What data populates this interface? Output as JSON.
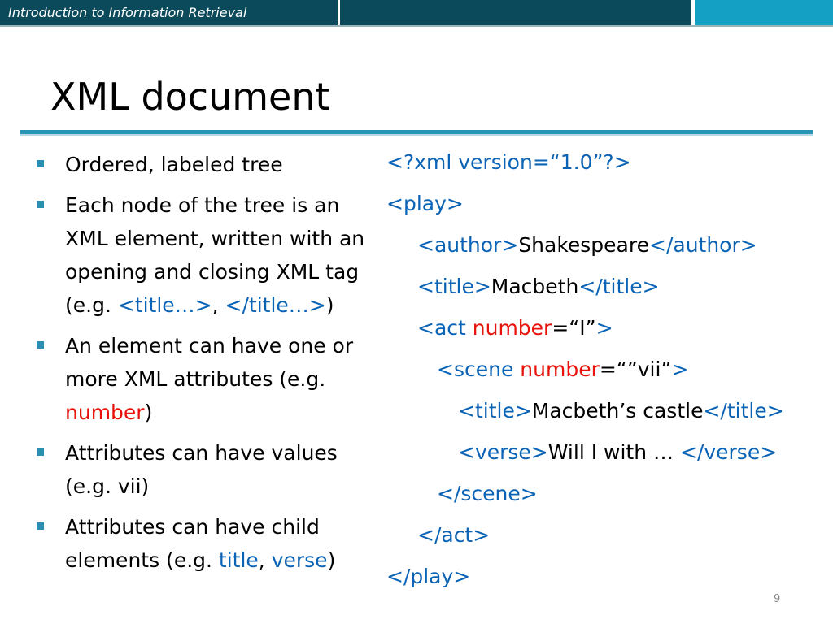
{
  "header": {
    "course": "Introduction to Information Retrieval"
  },
  "slide": {
    "title": "XML document",
    "page_number": "9",
    "colors": {
      "bar_dark": "#0b4a5a",
      "bar_light": "#14a0c4",
      "rule": "#2794b8",
      "tag_blue": "#0a63b5",
      "attr_red": "#e8120b"
    }
  },
  "bullets": {
    "b1": {
      "t1": "Ordered, labeled tree"
    },
    "b2": {
      "t1": "Each node of the tree is an XML element, written with an opening and closing XML tag (e.g. ",
      "t2": "<title…>",
      "t3": ", ",
      "t4": "</title…>",
      "t5": ")"
    },
    "b3": {
      "t1": "An element can have one or more XML attributes (e.g. ",
      "t2": "number",
      "t3": ")"
    },
    "b4": {
      "t1": "Attributes can have values (e.g. vii)"
    },
    "b5": {
      "t1": "Attributes can have  child elements (e.g. ",
      "t2": "title",
      "t3": ", ",
      "t4": "verse",
      "t5": ")"
    }
  },
  "code": {
    "l1": {
      "a": "<?xml version=“1.0”?>"
    },
    "l2": {
      "a": "<play>"
    },
    "l3": {
      "a": "<author>",
      "b": "Shakespeare",
      "c": "</author>"
    },
    "l4": {
      "a": "<title>",
      "b": "Macbeth",
      "c": "</title>"
    },
    "l5": {
      "a": "<act ",
      "b": "number",
      "c": "=“I”",
      "d": ">"
    },
    "l6": {
      "a": "<scene  ",
      "b": "number",
      "c": "=“”vii”",
      "d": ">"
    },
    "l7": {
      "a": "<title>",
      "b": "Macbeth’s castle",
      "c": "</title>"
    },
    "l8": {
      "a": "<verse>",
      "b": "Will I with … ",
      "c": "</verse>"
    },
    "l9": {
      "a": "</scene>"
    },
    "l10": {
      "a": "</act>"
    },
    "l11": {
      "a": "</play>"
    }
  }
}
